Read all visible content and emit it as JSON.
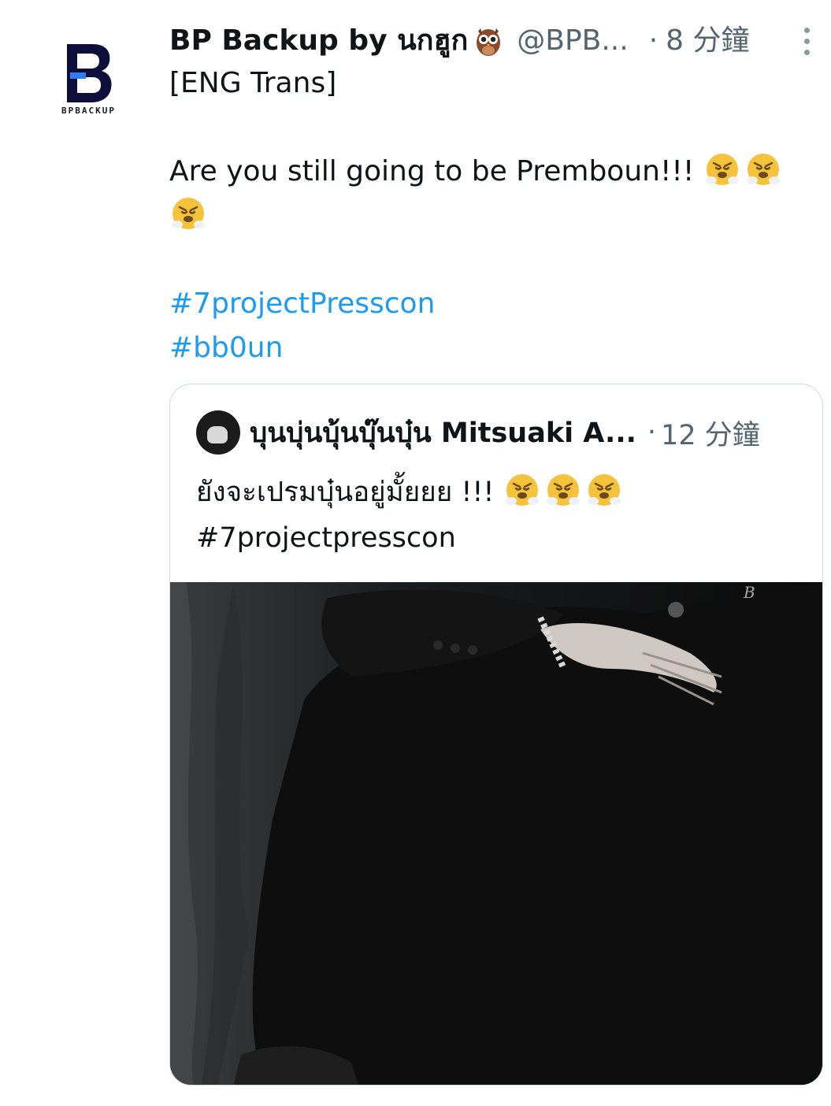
{
  "tweet": {
    "display_name": "BP Backup by นกฮูก",
    "handle": "@BPB...",
    "separator": "·",
    "time": "8 分鐘",
    "avatar_text": "BPBACKUP",
    "owl_icon": "owl-emoji",
    "more_icon": "more-vertical-icon",
    "lines": {
      "l1": "[ENG Trans]",
      "l2": "Are you still going to be Premboun!!!"
    },
    "hashtags": [
      "#7projectPresscon",
      "#bb0un"
    ],
    "emoji": "face-with-steam-from-nose"
  },
  "quote": {
    "display_name": "บุนบุ่นบุ้นบุ๊นบุ๋น Mitsuaki A...",
    "separator": "·",
    "time": "12 分鐘",
    "text": "ยังจะเปรมบุ๋นอยู่มั้ยยย !!!",
    "hashtag": "#7projectpresscon",
    "photo_desc_icon": "photo-image"
  },
  "colors": {
    "link": "#1d9bf0",
    "secondary_text": "#536471",
    "border": "#cfd9de"
  }
}
